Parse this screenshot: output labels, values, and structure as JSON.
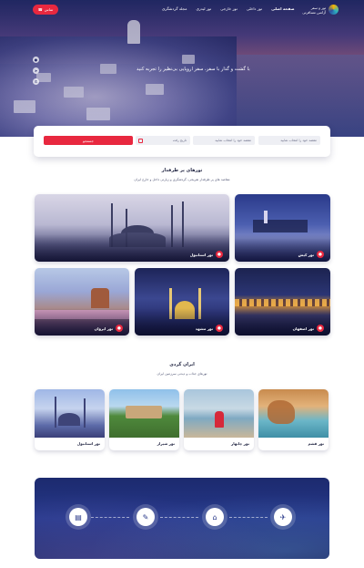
{
  "header": {
    "call_label": "تماس",
    "nav": [
      "صفحه اصلی",
      "تور داخلی",
      "تور خارجی",
      "تور لیدری",
      "مجله گردشگری"
    ],
    "logo_line1": "تور و سفر",
    "logo_line2": "آژانس مسافرتی"
  },
  "hero": {
    "caption": "با گشت و گذار با سفر، سفر اروپایی بی‌نظیر را تجربه کنید"
  },
  "search": {
    "origin_placeholder": "مقصد خود را انتخاب نمایید",
    "dest_placeholder": "مقصد خود را انتخاب نمایید",
    "date_placeholder": "تاریخ رفت",
    "button_label": "جستجو"
  },
  "popular": {
    "title": "تورهای پر طرفدار",
    "subtitle": "مقاصد های پر طرفدار تفریحی، گردشگری و زیارتی داخل و خارج ایران",
    "cards": [
      {
        "label": "تور استانبول"
      },
      {
        "label": "تور کیش"
      },
      {
        "label": "تور ایروان"
      },
      {
        "label": "تور مشهد"
      },
      {
        "label": "تور اصفهان"
      }
    ]
  },
  "iran": {
    "title": "ایران گردی",
    "subtitle": "تورهای جذاب و دیدنی سرزمین ایران",
    "cards": [
      {
        "label": "تور استانبول"
      },
      {
        "label": "تور شیراز"
      },
      {
        "label": "تور چابهار"
      },
      {
        "label": "تور قشم"
      }
    ]
  },
  "banner": {
    "steps": [
      "passport-icon",
      "ticket-icon",
      "hotel-icon",
      "plane-icon"
    ]
  },
  "colors": {
    "accent": "#e8283f",
    "navy": "#1f2340"
  }
}
